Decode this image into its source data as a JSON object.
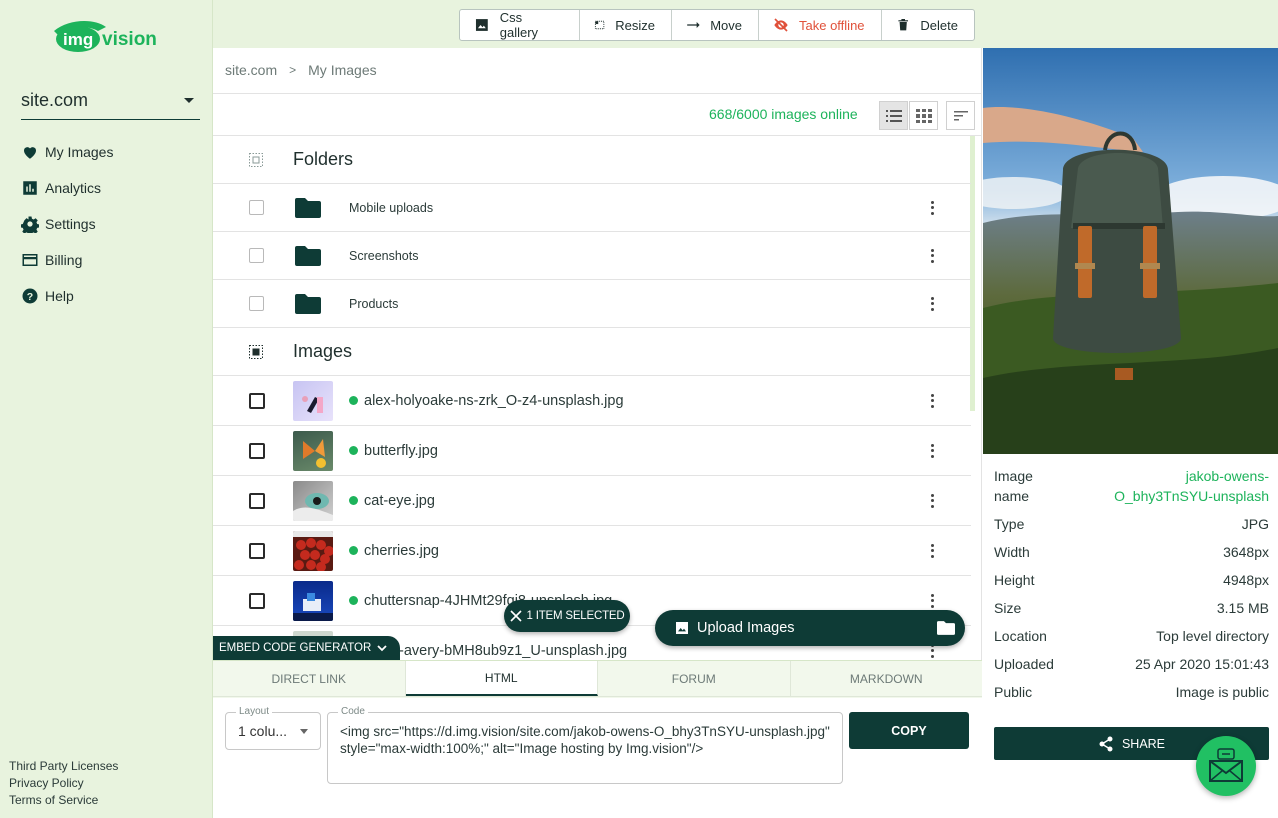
{
  "app": {
    "logo_text": "img vision"
  },
  "sidebar": {
    "site": "site.com",
    "items": [
      {
        "label": "My Images"
      },
      {
        "label": "Analytics"
      },
      {
        "label": "Settings"
      },
      {
        "label": "Billing"
      },
      {
        "label": "Help"
      }
    ],
    "footer": [
      "Third Party Licenses",
      "Privacy Policy",
      "Terms of Service"
    ]
  },
  "toolbar": {
    "gallery": "Css gallery",
    "resize": "Resize",
    "move": "Move",
    "offline": "Take offline",
    "delete": "Delete"
  },
  "breadcrumb": {
    "root": "site.com",
    "sep": ">",
    "current": "My Images"
  },
  "online_count": "668/6000 images online",
  "folders": {
    "title": "Folders",
    "items": [
      {
        "name": "Mobile uploads"
      },
      {
        "name": "Screenshots"
      },
      {
        "name": "Products"
      }
    ]
  },
  "images": {
    "title": "Images",
    "items": [
      {
        "name": "alex-holyoake-ns-zrk_O-z4-unsplash.jpg"
      },
      {
        "name": "butterfly.jpg"
      },
      {
        "name": "cat-eye.jpg"
      },
      {
        "name": "cherries.jpg"
      },
      {
        "name": "chuttersnap-4JHMt29fqj8-unsplash.jpg"
      },
      {
        "name": "-avery-bMH8ub9z1_U-unsplash.jpg"
      }
    ]
  },
  "pills": {
    "selected": "1 ITEM SELECTED",
    "upload": "Upload Images"
  },
  "embed": {
    "tab_label": "EMBED CODE GENERATOR",
    "tabs": [
      "DIRECT LINK",
      "HTML",
      "FORUM",
      "MARKDOWN"
    ],
    "layout_label": "Layout",
    "layout_value": "1 colu...",
    "code_label": "Code",
    "code_value": "<img src=\"https://d.img.vision/site.com/jakob-owens-O_bhy3TnSYU-unsplash.jpg\" style=\"max-width:100%;\" alt=\"Image hosting by Img.vision\"/>",
    "copy": "COPY"
  },
  "details": {
    "name_key": "Image\nname",
    "name_value": "jakob-owens-O_bhy3TnSYU-unsplash",
    "rows": [
      {
        "k": "Type",
        "v": "JPG"
      },
      {
        "k": "Width",
        "v": "3648px"
      },
      {
        "k": "Height",
        "v": "4948px"
      },
      {
        "k": "Size",
        "v": "3.15 MB"
      },
      {
        "k": "Location",
        "v": "Top level directory"
      },
      {
        "k": "Uploaded",
        "v": "25 Apr 2020 15:01:43"
      },
      {
        "k": "Public",
        "v": "Image is public"
      }
    ],
    "share": "SHARE"
  },
  "colors": {
    "primary": "#0e3b36",
    "accent": "#1db35b",
    "sidebar_bg": "#e8f3de",
    "danger": "#e0513a"
  }
}
